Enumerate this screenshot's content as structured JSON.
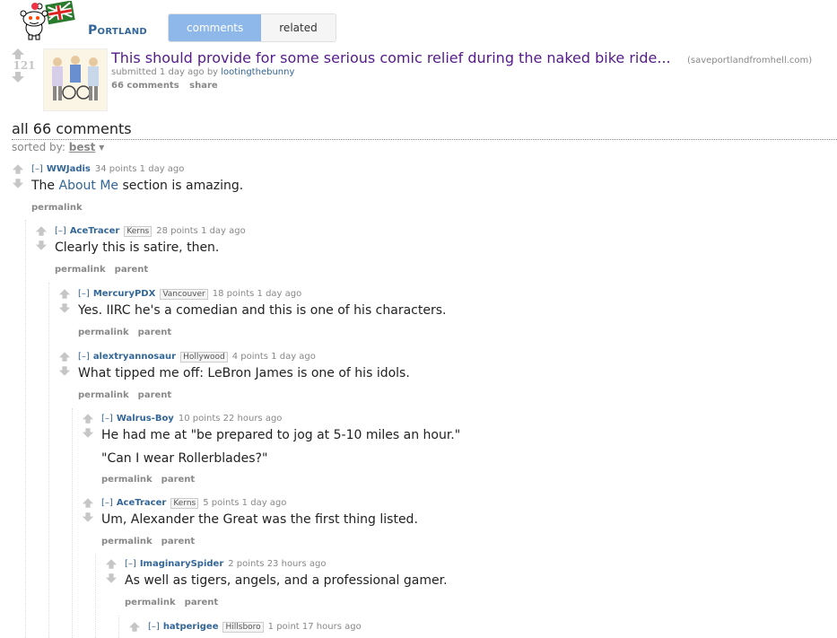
{
  "header": {
    "subreddit": "Portland",
    "tabs": [
      {
        "label": "comments",
        "active": true
      },
      {
        "label": "related",
        "active": false
      }
    ]
  },
  "post": {
    "score": "121",
    "title": "This should provide for some serious comic relief during the naked bike ride...",
    "domain": "(saveportlandfromhell.com)",
    "submitted_prefix": "submitted 1 day ago by",
    "author": "lootingthebunny",
    "comments_link": "66 comments",
    "share_link": "share"
  },
  "comments_header": "all 66 comments",
  "sort": {
    "label": "sorted by:",
    "value": "best"
  },
  "comments": [
    {
      "toggle": "[–]",
      "author": "WWJadis",
      "flair": "",
      "meta": "34 points 1 day ago",
      "body_pre": "The ",
      "body_link": "About Me",
      "body_post": " section is amazing.",
      "buttons": [
        "permalink"
      ]
    },
    {
      "toggle": "[–]",
      "author": "AceTracer",
      "flair": "Kerns",
      "meta": "28 points 1 day ago",
      "body": "Clearly this is satire, then.",
      "buttons": [
        "permalink",
        "parent"
      ]
    },
    {
      "toggle": "[–]",
      "author": "MercuryPDX",
      "flair": "Vancouver",
      "meta": "18 points 1 day ago",
      "body": "Yes. IIRC he's a comedian and this is one of his characters.",
      "buttons": [
        "permalink",
        "parent"
      ]
    },
    {
      "toggle": "[–]",
      "author": "alextryannosaur",
      "flair": "Hollywood",
      "meta": "4 points 1 day ago",
      "body": "What tipped me off: LeBron James is one of his idols.",
      "buttons": [
        "permalink",
        "parent"
      ]
    },
    {
      "toggle": "[–]",
      "author": "Walrus-Boy",
      "flair": "",
      "meta": "10 points 22 hours ago",
      "body": "He had me at \"be prepared to jog at 5-10 miles an hour.\"",
      "body2": "\"Can I wear Rollerblades?\"",
      "buttons": [
        "permalink",
        "parent"
      ]
    },
    {
      "toggle": "[–]",
      "author": "AceTracer",
      "flair": "Kerns",
      "meta": "5 points 1 day ago",
      "body": "Um, Alexander the Great was the first thing listed.",
      "buttons": [
        "permalink",
        "parent"
      ]
    },
    {
      "toggle": "[–]",
      "author": "ImaginarySpider",
      "flair": "",
      "meta": "2 points 23 hours ago",
      "body": "As well as tigers, angels, and a professional gamer.",
      "buttons": [
        "permalink",
        "parent"
      ]
    },
    {
      "toggle": "[–]",
      "author": "hatperigee",
      "flair": "Hillsboro",
      "meta": "1 point 17 hours ago",
      "body": "",
      "buttons": []
    }
  ]
}
